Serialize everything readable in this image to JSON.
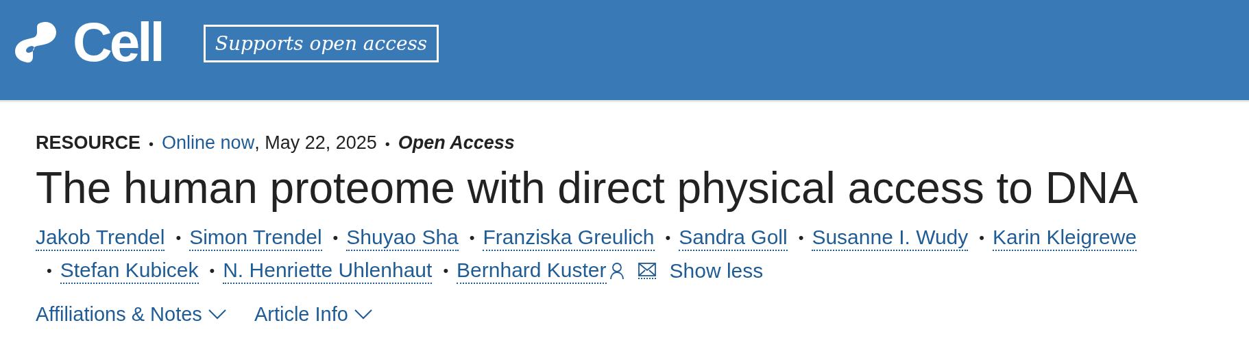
{
  "header": {
    "logo_text": "Cell",
    "badge": "Supports open access"
  },
  "meta": [
    {
      "kind": "type",
      "text": "RESOURCE"
    },
    {
      "kind": "sep",
      "text": "•"
    },
    {
      "kind": "link",
      "text": "Online now"
    },
    {
      "kind": "plain",
      "text": ", May 22, 2025"
    },
    {
      "kind": "sep",
      "text": "•"
    },
    {
      "kind": "emph",
      "text": "Open Access"
    }
  ],
  "title": "The human proteome with direct physical access to DNA",
  "authors": [
    {
      "name": "Jakob Trendel",
      "corresponding": false
    },
    {
      "prefix": "•",
      "name": "Simon Trendel",
      "corresponding": false
    },
    {
      "prefix": "•",
      "name": "Shuyao Sha",
      "corresponding": false
    },
    {
      "prefix": "•",
      "name": "Franziska Greulich",
      "corresponding": false
    },
    {
      "prefix": "•",
      "name": "Sandra Goll",
      "corresponding": false
    },
    {
      "prefix": "•",
      "name": "Susanne I. Wudy",
      "corresponding": false
    },
    {
      "prefix": "•",
      "name": "Karin Kleigrewe",
      "corresponding": false
    },
    {
      "prefix": "•",
      "name": "Stefan Kubicek",
      "corresponding": false
    },
    {
      "prefix": "•",
      "name": "N. Henriette Uhlenhaut",
      "corresponding": false
    },
    {
      "prefix": "•",
      "name": "Bernhard Kuster",
      "corresponding": true
    }
  ],
  "show_less": "Show less",
  "sections": [
    {
      "label": "Affiliations & Notes",
      "expanded": false
    },
    {
      "label": "Article Info",
      "expanded": false
    }
  ]
}
